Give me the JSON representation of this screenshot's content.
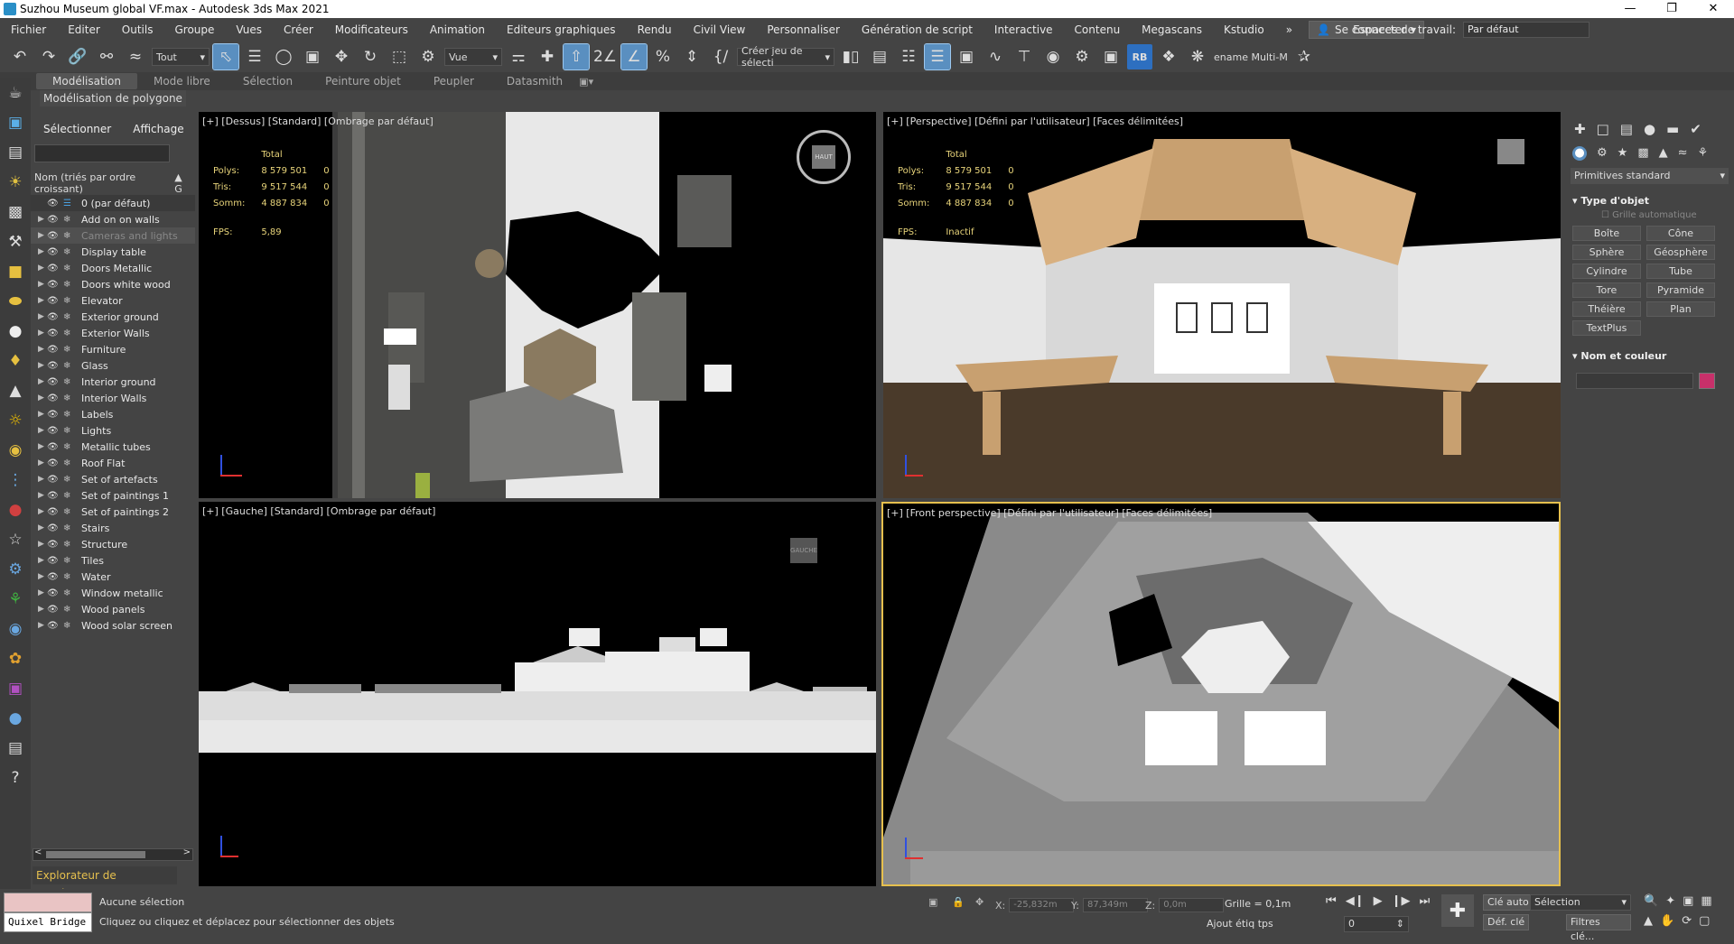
{
  "titlebar": {
    "title": "Suzhou Museum global VF.max - Autodesk 3ds Max 2021",
    "minimize": "—",
    "maximize": "❐",
    "close": "✕"
  },
  "menu": {
    "items": [
      "Fichier",
      "Editer",
      "Outils",
      "Groupe",
      "Vues",
      "Créer",
      "Modificateurs",
      "Animation",
      "Editeurs graphiques",
      "Rendu",
      "Civil View",
      "Personnaliser",
      "Génération de script",
      "Interactive",
      "Contenu",
      "Megascans",
      "Kstudio"
    ],
    "more": "»",
    "signin": "Se connecter",
    "signin_arrow": "▾",
    "workspace_label": "Espaces de travail:",
    "workspace_value": "Par défaut"
  },
  "toolbar": {
    "selection_filter": "Tout",
    "ref_coord": "Vue",
    "named_sel": "Créer jeu de sélecti",
    "rename_label": "ename Multi-M",
    "dd_arrow": "▾"
  },
  "ribbon": {
    "tabs": [
      "Modélisation",
      "Mode libre",
      "Sélection",
      "Peinture objet",
      "Peupler",
      "Datasmith"
    ],
    "sub": "Modélisation de polygone"
  },
  "scene_explorer": {
    "menu_select": "Sélectionner",
    "menu_display": "Affichage",
    "col_name": "Nom (triés par ordre croissant)",
    "col_sort": "▲ G",
    "layers": [
      "0 (par défaut)",
      "Add on on walls",
      "Cameras and lights",
      "Display table",
      "Doors Metallic",
      "Doors white wood",
      "Elevator",
      "Exterior ground",
      "Exterior Walls",
      "Furniture",
      "Glass",
      "Interior ground",
      "Interior Walls",
      "Labels",
      "Lights",
      "Metallic tubes",
      "Roof Flat",
      "Set of artefacts",
      "Set of paintings 1",
      "Set of paintings 2",
      "Stairs",
      "Structure",
      "Tiles",
      "Water",
      "Window metallic",
      "Wood panels",
      "Wood solar screen"
    ],
    "footer": "Explorateur de couches",
    "scroll_left": "<",
    "scroll_right": ">"
  },
  "viewports": {
    "top": {
      "label": "[+] [Dessus] [Standard] [Ombrage par défaut]",
      "total": "Total",
      "polys_label": "Polys:",
      "polys": "8 579 501",
      "tris_label": "Tris:",
      "tris": "9 517 544",
      "verts_label": "Somm:",
      "verts": "4 887 834",
      "zero": "0",
      "fps_label": "FPS:",
      "fps": "5,89",
      "compass_label": "HAUT"
    },
    "persp": {
      "label": "[+] [Perspective] [Défini par l'utilisateur] [Faces délimitées]",
      "total": "Total",
      "polys_label": "Polys:",
      "polys": "8 579 501",
      "tris_label": "Tris:",
      "tris": "9 517 544",
      "verts_label": "Somm:",
      "verts": "4 887 834",
      "zero": "0",
      "fps_label": "FPS:",
      "fps": "Inactif"
    },
    "left": {
      "label": "[+] [Gauche] [Standard] [Ombrage par défaut]",
      "cube_label": "GAUCHE"
    },
    "front": {
      "label": "[+] [Front perspective] [Défini par l'utilisateur] [Faces délimitées]"
    }
  },
  "command_panel": {
    "category": "Primitives standard",
    "rollout_type": "Type d'objet",
    "autogrid": "Grille automatique",
    "buttons": [
      "Boîte",
      "Cône",
      "Sphère",
      "Géosphère",
      "Cylindre",
      "Tube",
      "Tore",
      "Pyramide",
      "Théière",
      "Plan",
      "TextPlus"
    ],
    "rollout_name": "Nom et couleur",
    "color": "#c8306a"
  },
  "status": {
    "selection": "Aucune sélection",
    "prompt": "Cliquez ou cliquez et déplacez pour sélectionner des objets",
    "quixel": "Quixel Bridge",
    "x_label": "X:",
    "x": "-25,832m",
    "y_label": "Y:",
    "y": "87,349m",
    "z_label": "Z:",
    "z": "0,0m",
    "grid": "Grille = 0,1m",
    "add_tag": "Ajout étiq tps",
    "autokey": "Clé auto",
    "setkey": "Déf. clé",
    "key_filter": "Sélection",
    "frame": "0",
    "filters": "Filtres clé..."
  }
}
